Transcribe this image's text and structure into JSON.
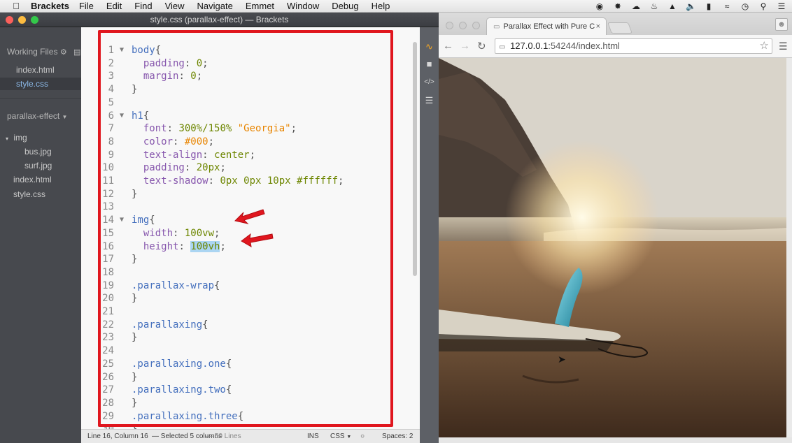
{
  "menubar": {
    "app_name": "Brackets",
    "menus": [
      "File",
      "Edit",
      "Find",
      "View",
      "Navigate",
      "Emmet",
      "Window",
      "Debug",
      "Help"
    ]
  },
  "brackets": {
    "window_title": "style.css (parallax-effect) — Brackets",
    "sidebar": {
      "working_files_label": "Working Files",
      "working_files": [
        "index.html",
        "style.css"
      ],
      "project_name": "parallax-effect",
      "tree": [
        {
          "name": "img",
          "type": "folder"
        },
        {
          "name": "bus.jpg",
          "type": "file"
        },
        {
          "name": "surf.jpg",
          "type": "file"
        },
        {
          "name": "index.html",
          "type": "file"
        },
        {
          "name": "style.css",
          "type": "file"
        }
      ]
    },
    "status": {
      "cursor": "Line 16, Column 16",
      "selection": "— Selected 5 columns",
      "lines": "— 50 Lines",
      "mode": "INS",
      "language": "CSS",
      "spaces": "Spaces: 2"
    }
  },
  "code_lines": [
    {
      "n": "1",
      "fold": true,
      "tokens": [
        [
          "sel",
          "body"
        ],
        [
          "p",
          "{"
        ]
      ]
    },
    {
      "n": "2",
      "tokens": [
        [
          "p",
          "  "
        ],
        [
          "prop",
          "padding"
        ],
        [
          "p",
          ": "
        ],
        [
          "num",
          "0"
        ],
        [
          "p",
          ";"
        ]
      ]
    },
    {
      "n": "3",
      "tokens": [
        [
          "p",
          "  "
        ],
        [
          "prop",
          "margin"
        ],
        [
          "p",
          ": "
        ],
        [
          "num",
          "0"
        ],
        [
          "p",
          ";"
        ]
      ]
    },
    {
      "n": "4",
      "tokens": [
        [
          "p",
          "}"
        ]
      ]
    },
    {
      "n": "5",
      "tokens": []
    },
    {
      "n": "6",
      "fold": true,
      "tokens": [
        [
          "sel",
          "h1"
        ],
        [
          "p",
          "{"
        ]
      ]
    },
    {
      "n": "7",
      "tokens": [
        [
          "p",
          "  "
        ],
        [
          "prop",
          "font"
        ],
        [
          "p",
          ": "
        ],
        [
          "num",
          "300%/150%"
        ],
        [
          "p",
          " "
        ],
        [
          "str",
          "\"Georgia\""
        ],
        [
          "p",
          ";"
        ]
      ]
    },
    {
      "n": "8",
      "tokens": [
        [
          "p",
          "  "
        ],
        [
          "prop",
          "color"
        ],
        [
          "p",
          ": "
        ],
        [
          "str",
          "#000"
        ],
        [
          "p",
          ";"
        ]
      ]
    },
    {
      "n": "9",
      "tokens": [
        [
          "p",
          "  "
        ],
        [
          "prop",
          "text-align"
        ],
        [
          "p",
          ": "
        ],
        [
          "num",
          "center"
        ],
        [
          "p",
          ";"
        ]
      ]
    },
    {
      "n": "10",
      "tokens": [
        [
          "p",
          "  "
        ],
        [
          "prop",
          "padding"
        ],
        [
          "p",
          ": "
        ],
        [
          "num",
          "20px"
        ],
        [
          "p",
          ";"
        ]
      ]
    },
    {
      "n": "11",
      "tokens": [
        [
          "p",
          "  "
        ],
        [
          "prop",
          "text-shadow"
        ],
        [
          "p",
          ": "
        ],
        [
          "num",
          "0px 0px 10px"
        ],
        [
          "p",
          " "
        ],
        [
          "num",
          "#ffffff"
        ],
        [
          "p",
          ";"
        ]
      ]
    },
    {
      "n": "12",
      "tokens": [
        [
          "p",
          "}"
        ]
      ]
    },
    {
      "n": "13",
      "tokens": []
    },
    {
      "n": "14",
      "fold": true,
      "tokens": [
        [
          "sel",
          "img"
        ],
        [
          "p",
          "{"
        ]
      ]
    },
    {
      "n": "15",
      "tokens": [
        [
          "p",
          "  "
        ],
        [
          "prop",
          "width"
        ],
        [
          "p",
          ": "
        ],
        [
          "num",
          "100vw"
        ],
        [
          "p",
          ";"
        ]
      ]
    },
    {
      "n": "16",
      "tokens": [
        [
          "p",
          "  "
        ],
        [
          "prop",
          "height"
        ],
        [
          "p",
          ": "
        ],
        [
          "hl",
          "100vh"
        ],
        [
          "p",
          ";"
        ]
      ]
    },
    {
      "n": "17",
      "tokens": [
        [
          "p",
          "}"
        ]
      ]
    },
    {
      "n": "18",
      "tokens": []
    },
    {
      "n": "19",
      "tokens": [
        [
          "sel",
          ".parallax-wrap"
        ],
        [
          "p",
          "{"
        ]
      ]
    },
    {
      "n": "20",
      "tokens": [
        [
          "p",
          "}"
        ]
      ]
    },
    {
      "n": "21",
      "tokens": []
    },
    {
      "n": "22",
      "tokens": [
        [
          "sel",
          ".parallaxing"
        ],
        [
          "p",
          "{"
        ]
      ]
    },
    {
      "n": "23",
      "tokens": [
        [
          "p",
          "}"
        ]
      ]
    },
    {
      "n": "24",
      "tokens": []
    },
    {
      "n": "25",
      "tokens": [
        [
          "sel",
          ".parallaxing.one"
        ],
        [
          "p",
          "{"
        ]
      ]
    },
    {
      "n": "26",
      "tokens": [
        [
          "p",
          "}"
        ]
      ]
    },
    {
      "n": "27",
      "tokens": [
        [
          "sel",
          ".parallaxing.two"
        ],
        [
          "p",
          "{"
        ]
      ]
    },
    {
      "n": "28",
      "tokens": [
        [
          "p",
          "}"
        ]
      ]
    },
    {
      "n": "29",
      "tokens": [
        [
          "sel",
          ".parallaxing.three"
        ],
        [
          "p",
          "{"
        ]
      ]
    },
    {
      "n": "30",
      "tokens": [
        [
          "p",
          "}"
        ]
      ]
    }
  ],
  "chrome": {
    "tab_title": "Parallax Effect with Pure C",
    "url_host": "127.0.0.1",
    "url_rest": ":54244/index.html"
  },
  "colors": {
    "annotation_red": "#e0161e"
  }
}
